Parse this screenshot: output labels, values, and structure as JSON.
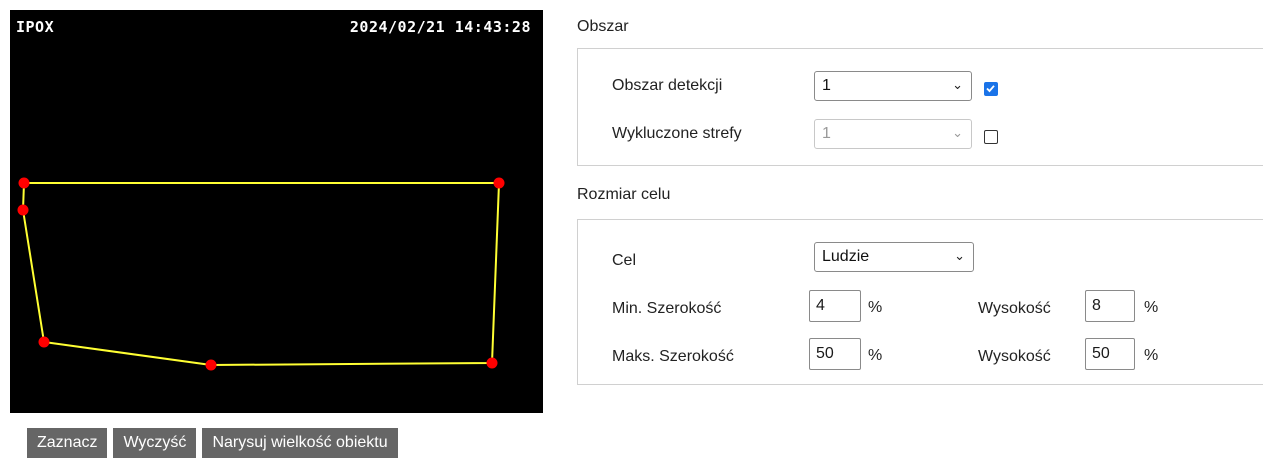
{
  "video": {
    "osd_name": "IPOX",
    "osd_timestamp": "2024/02/21 14:43:28",
    "polygon_color": "#ffff33",
    "vertex_color": "#ff0000"
  },
  "buttons": {
    "mark": "Zaznacz",
    "clear": "Wyczyść",
    "draw_size": "Narysuj wielkość obiektu"
  },
  "area": {
    "title": "Obszar",
    "detection_label": "Obszar detekcji",
    "detection_value": "1",
    "detection_checked": true,
    "excluded_label": "Wykluczone strefy",
    "excluded_value": "1",
    "excluded_checked": false
  },
  "target": {
    "title": "Rozmiar celu",
    "target_label": "Cel",
    "target_value": "Ludzie",
    "min_width_label": "Min. Szerokość",
    "min_width_value": "4",
    "min_height_label": "Wysokość",
    "min_height_value": "8",
    "max_width_label": "Maks. Szerokość",
    "max_width_value": "50",
    "max_height_label": "Wysokość",
    "max_height_value": "50",
    "percent": "%"
  },
  "accent_color": "#1a73e8"
}
